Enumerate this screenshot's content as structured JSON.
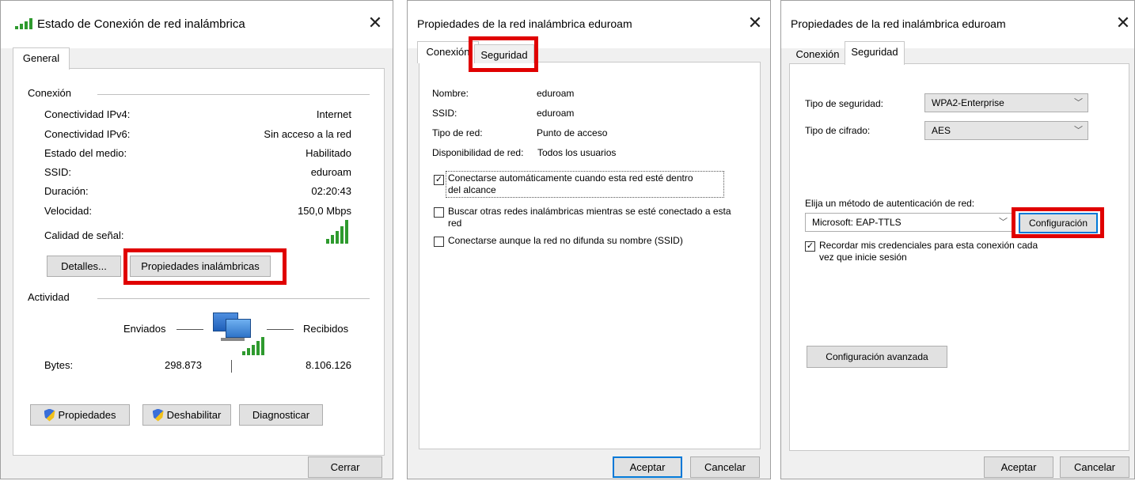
{
  "dialog1": {
    "title": "Estado de Conexión de red inalámbrica",
    "tab": "General",
    "connection_group": "Conexión",
    "rows": [
      {
        "label": "Conectividad IPv4:",
        "value": "Internet"
      },
      {
        "label": "Conectividad IPv6:",
        "value": "Sin acceso a la red"
      },
      {
        "label": "Estado del medio:",
        "value": "Habilitado"
      },
      {
        "label": "SSID:",
        "value": "eduroam"
      },
      {
        "label": "Duración:",
        "value": "02:20:43"
      },
      {
        "label": "Velocidad:",
        "value": "150,0 Mbps"
      }
    ],
    "signal_label": "Calidad de señal:",
    "details_button": "Detalles...",
    "wireless_props_button": "Propiedades inalámbricas",
    "activity_group": "Actividad",
    "sent_label": "Enviados",
    "received_label": "Recibidos",
    "bytes_label": "Bytes:",
    "bytes_sent": "298.873",
    "bytes_received": "8.106.126",
    "properties_button": "Propiedades",
    "disable_button": "Deshabilitar",
    "diagnose_button": "Diagnosticar",
    "close_button": "Cerrar"
  },
  "dialog2": {
    "title": "Propiedades de la red inalámbrica eduroam",
    "tabs": [
      "Conexión",
      "Seguridad"
    ],
    "fields": [
      {
        "label": "Nombre:",
        "value": "eduroam"
      },
      {
        "label": "SSID:",
        "value": "eduroam"
      },
      {
        "label": "Tipo de red:",
        "value": "Punto de acceso"
      },
      {
        "label": "Disponibilidad de red:",
        "value": "Todos los usuarios"
      }
    ],
    "checkboxes": [
      {
        "label_line1": "Conectarse automáticamente cuando esta red esté dentro",
        "label_line2": "del alcance",
        "checked": true
      },
      {
        "label_line1": "Buscar otras redes inalámbricas mientras se esté conectado a esta",
        "label_line2": "red",
        "checked": false
      },
      {
        "label_line1": "Conectarse aunque la red no difunda su nombre (SSID)",
        "label_line2": "",
        "checked": false
      }
    ],
    "ok_button": "Aceptar",
    "cancel_button": "Cancelar"
  },
  "dialog3": {
    "title": "Propiedades de la red inalámbrica eduroam",
    "tabs": [
      "Conexión",
      "Seguridad"
    ],
    "security_type_label": "Tipo de seguridad:",
    "security_type_value": "WPA2-Enterprise",
    "encryption_type_label": "Tipo de cifrado:",
    "encryption_type_value": "AES",
    "auth_method_label": "Elija un método de autenticación de red:",
    "auth_method_value": "Microsoft: EAP-TTLS",
    "settings_button": "Configuración",
    "remember_label_line1": "Recordar mis credenciales para esta conexión cada",
    "remember_label_line2": "vez que inicie sesión",
    "remember_checked": true,
    "advanced_button": "Configuración avanzada",
    "ok_button": "Aceptar",
    "cancel_button": "Cancelar"
  },
  "colors": {
    "highlight": "#e00000",
    "signal": "#2e9a2e",
    "accent": "#0078d7"
  }
}
